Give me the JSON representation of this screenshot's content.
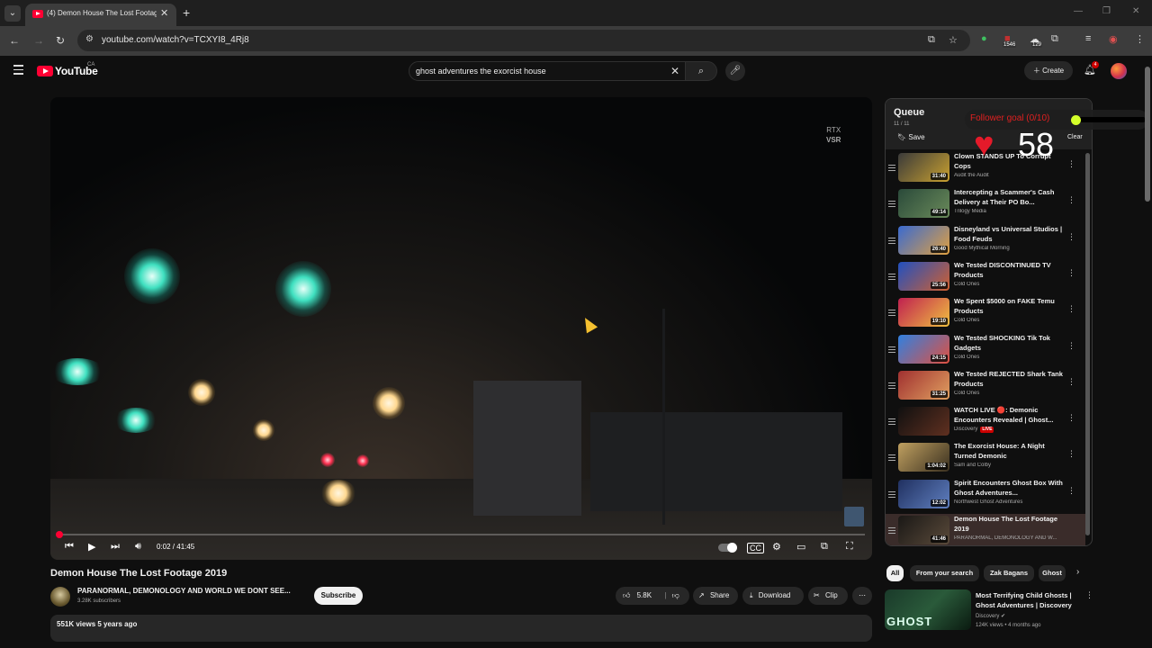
{
  "browser": {
    "tab_title": "(4) Demon House The Lost Footage",
    "url": "youtube.com/watch?v=TCXYI8_4Rj8",
    "ext_badge_1": "1546",
    "ext_badge_2": "129"
  },
  "header": {
    "logo": "YouTube",
    "region": "CA",
    "search_query": "ghost adventures the exorcist house",
    "create_label": "Create",
    "notif_count": "4"
  },
  "player": {
    "rtx_label_1": "RTX",
    "rtx_label_2": "VSR",
    "time": "0:02 / 41:45",
    "progress": 0.0008
  },
  "video": {
    "title": "Demon House The Lost Footage 2019",
    "channel": "PARANORMAL, DEMONOLOGY AND WORLD WE DONT SEE...",
    "subscribers": "3.28K subscribers",
    "subscribe_label": "Subscribe",
    "likes": "5.8K",
    "share_label": "Share",
    "download_label": "Download",
    "clip_label": "Clip",
    "views_date": "551K views  5 years ago"
  },
  "overlay": {
    "goal_text": "Follower goal (0/10)",
    "heart_rate": "58"
  },
  "queue": {
    "title": "Queue",
    "count": "11 / 11",
    "save_label": "Save",
    "clear_label": "Clear",
    "items": [
      {
        "title": "Clown STANDS UP To Corrupt Cops",
        "channel": "Audit the Audit",
        "duration": "31:40",
        "c1": "#3a3a3a",
        "c2": "#c8a030"
      },
      {
        "title": "Intercepting a Scammer's Cash Delivery at Their PO Bo...",
        "channel": "Trilogy Media",
        "duration": "49:14",
        "c1": "#2a4a3a",
        "c2": "#6a8a5a"
      },
      {
        "title": "Disneyland vs Universal Studios | Food Feuds",
        "channel": "Good Mythical Morning",
        "duration": "26:40",
        "c1": "#3a6ad0",
        "c2": "#e0a040"
      },
      {
        "title": "We Tested DISCONTINUED TV Products",
        "channel": "Cold Ones",
        "duration": "25:56",
        "c1": "#2050c0",
        "c2": "#d06030"
      },
      {
        "title": "We Spent $5000 on FAKE Temu Products",
        "channel": "Cold Ones",
        "duration": "19:10",
        "c1": "#c02050",
        "c2": "#f0c040"
      },
      {
        "title": "We Tested SHOCKING Tik Tok Gadgets",
        "channel": "Cold Ones",
        "duration": "24:15",
        "c1": "#3080e0",
        "c2": "#e05040"
      },
      {
        "title": "We Tested REJECTED Shark Tank Products",
        "channel": "Cold Ones",
        "duration": "31:25",
        "c1": "#a03030",
        "c2": "#e0a060"
      },
      {
        "title": "WATCH LIVE 🔴: Demonic Encounters Revealed | Ghost...",
        "channel": "Discovery",
        "duration": "",
        "live": "LIVE",
        "c1": "#101010",
        "c2": "#603020"
      },
      {
        "title": "The Exorcist House: A Night Turned Demonic",
        "channel": "Sam and Colby",
        "duration": "1:04:02",
        "c1": "#c0a060",
        "c2": "#3a3020"
      },
      {
        "title": "Spirit Encounters Ghost Box With Ghost Adventures...",
        "channel": "Northwest Ghost Adventures",
        "duration": "12:02",
        "c1": "#203060",
        "c2": "#6080c0"
      },
      {
        "title": "Demon House The Lost Footage 2019",
        "channel": "PARANORMAL, DEMONOLOGY AND W...",
        "duration": "41:46",
        "c1": "#1a1816",
        "c2": "#5a4a3a"
      }
    ]
  },
  "chips": [
    "All",
    "From your search",
    "Zak Bagans",
    "Ghost"
  ],
  "suggested": {
    "title": "Most Terrifying Child Ghosts | Ghost Adventures | Discovery",
    "channel": "Discovery",
    "meta": "124K views • 4 months ago",
    "thumb_text": "GHOST"
  }
}
